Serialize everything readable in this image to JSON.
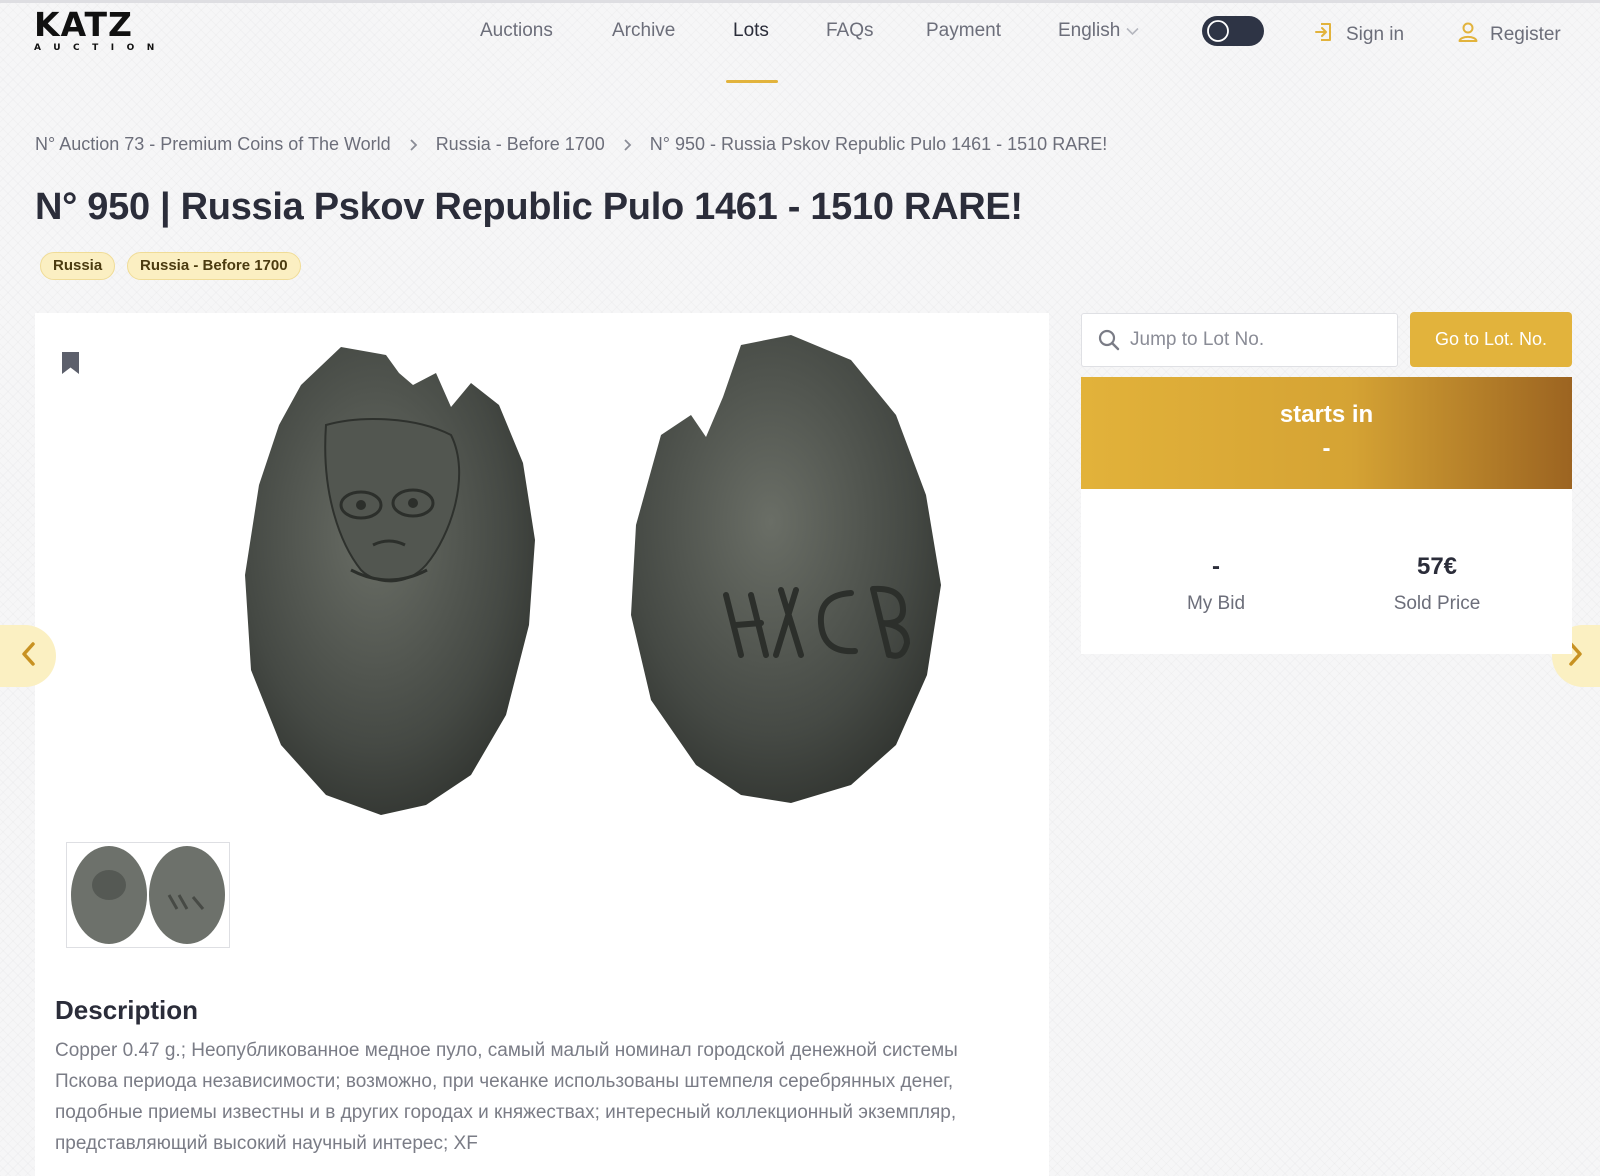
{
  "brand": {
    "name": "KATZ",
    "tagline": "AUCTION"
  },
  "nav": {
    "items": [
      {
        "label": "Auctions"
      },
      {
        "label": "Archive"
      },
      {
        "label": "Lots"
      },
      {
        "label": "FAQs"
      },
      {
        "label": "Payment"
      }
    ],
    "active": "Lots",
    "language": "English",
    "sign_in": "Sign in",
    "register": "Register"
  },
  "breadcrumb": [
    "N° Auction 73 - Premium Coins of The World",
    "Russia - Before 1700",
    "N° 950 - Russia Pskov Republic Pulo 1461 - 1510 RARE!"
  ],
  "lot": {
    "title": "N° 950 | Russia Pskov Republic Pulo 1461 - 1510 RARE!",
    "tags": [
      "Russia",
      "Russia - Before 1700"
    ],
    "description_title": "Description",
    "description": "Copper 0.47 g.; Неопубликованное медное пуло, самый малый номинал городской денежной системы Пскова периода независимости; возможно, при чеканке использованы штемпеля серебрянных денег, подобные приемы известны и в других городах и княжествах; интересный коллекционный экземпляр, представляющий высокий научный интерес; XF"
  },
  "sidebar": {
    "jump_placeholder": "Jump to Lot No.",
    "go_button": "Go to Lot. No.",
    "starts_label": "starts in",
    "starts_value": "-",
    "my_bid_value": "-",
    "my_bid_label": "My Bid",
    "sold_price_value": "57€",
    "sold_price_label": "Sold Price"
  },
  "colors": {
    "accent": "#e2b33c",
    "tag_bg": "#fbefc2",
    "text": "#2b2d3a",
    "muted": "#6c6e7a"
  },
  "icons": [
    "bookmark-icon",
    "search-icon",
    "chevron-left-icon",
    "chevron-right-icon",
    "sign-in-icon",
    "user-icon",
    "moon-icon",
    "chevron-down-icon",
    "breadcrumb-chevron-icon"
  ]
}
